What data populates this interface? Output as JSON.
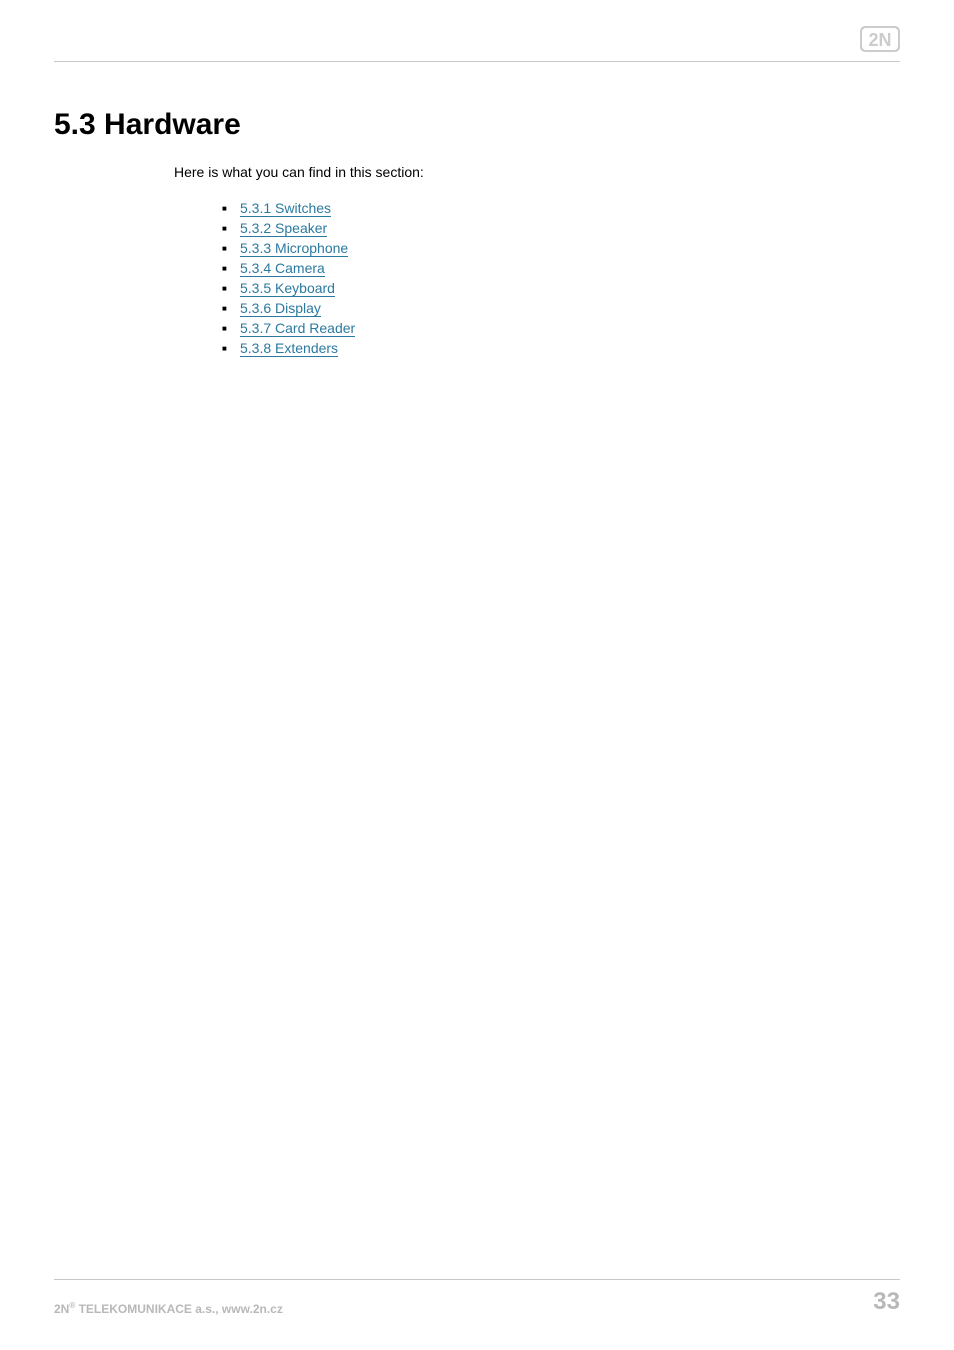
{
  "header": {
    "logo_alt": "2N"
  },
  "heading": "5.3 Hardware",
  "intro": "Here is what you can find in this section:",
  "toc": [
    {
      "label": "5.3.1 Switches"
    },
    {
      "label": "5.3.2 Speaker"
    },
    {
      "label": "5.3.3 Microphone"
    },
    {
      "label": "5.3.4 Camera"
    },
    {
      "label": "5.3.5 Keyboard"
    },
    {
      "label": "5.3.6 Display"
    },
    {
      "label": "5.3.7 Card Reader"
    },
    {
      "label": "5.3.8 Extenders"
    }
  ],
  "footer": {
    "company_prefix": "2N",
    "company_sup": "®",
    "company_rest": " TELEKOMUNIKACE a.s., www.2n.cz",
    "page_number": "33"
  }
}
